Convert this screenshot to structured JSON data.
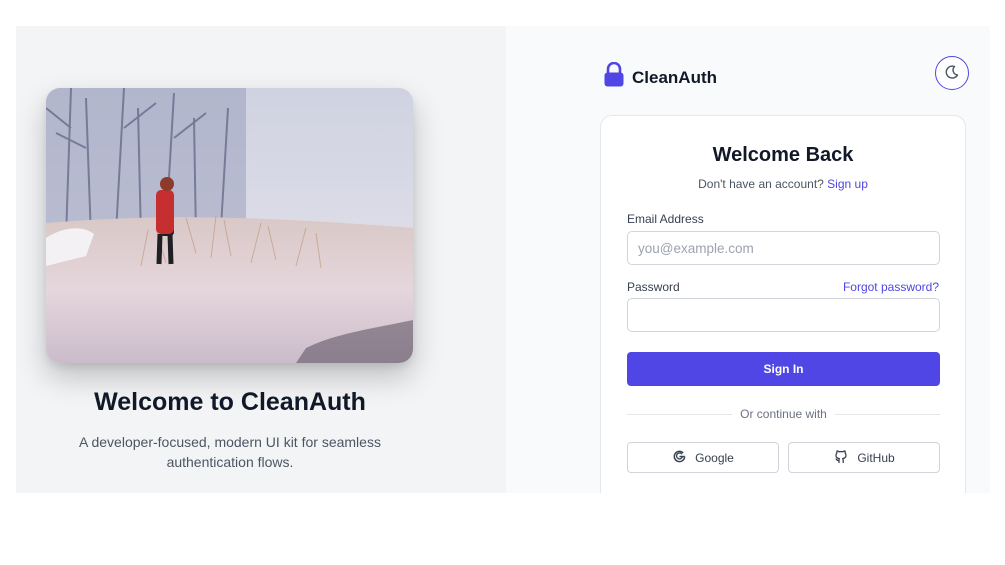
{
  "colors": {
    "accent": "#4f46e5",
    "left_bg": "#f3f4f6",
    "right_bg": "#f9fafb"
  },
  "hero": {
    "title": "Welcome to CleanAuth",
    "subtitle": "A developer-focused, modern UI kit for seamless authentication flows.",
    "image_icon": "snowy-field-photo"
  },
  "brand": {
    "name": "CleanAuth",
    "icon": "lock-icon"
  },
  "theme_toggle": {
    "icon": "moon-icon"
  },
  "login_card": {
    "title": "Welcome Back",
    "signup_prompt": "Don't have an account?",
    "signup_link": "Sign up",
    "email": {
      "label": "Email Address",
      "placeholder": "you@example.com",
      "value": ""
    },
    "password": {
      "label": "Password",
      "value": ""
    },
    "forgot_link": "Forgot password?",
    "submit_label": "Sign In",
    "divider_text": "Or continue with",
    "social": [
      {
        "label": "Google",
        "icon": "google-icon"
      },
      {
        "label": "GitHub",
        "icon": "github-icon"
      }
    ]
  }
}
